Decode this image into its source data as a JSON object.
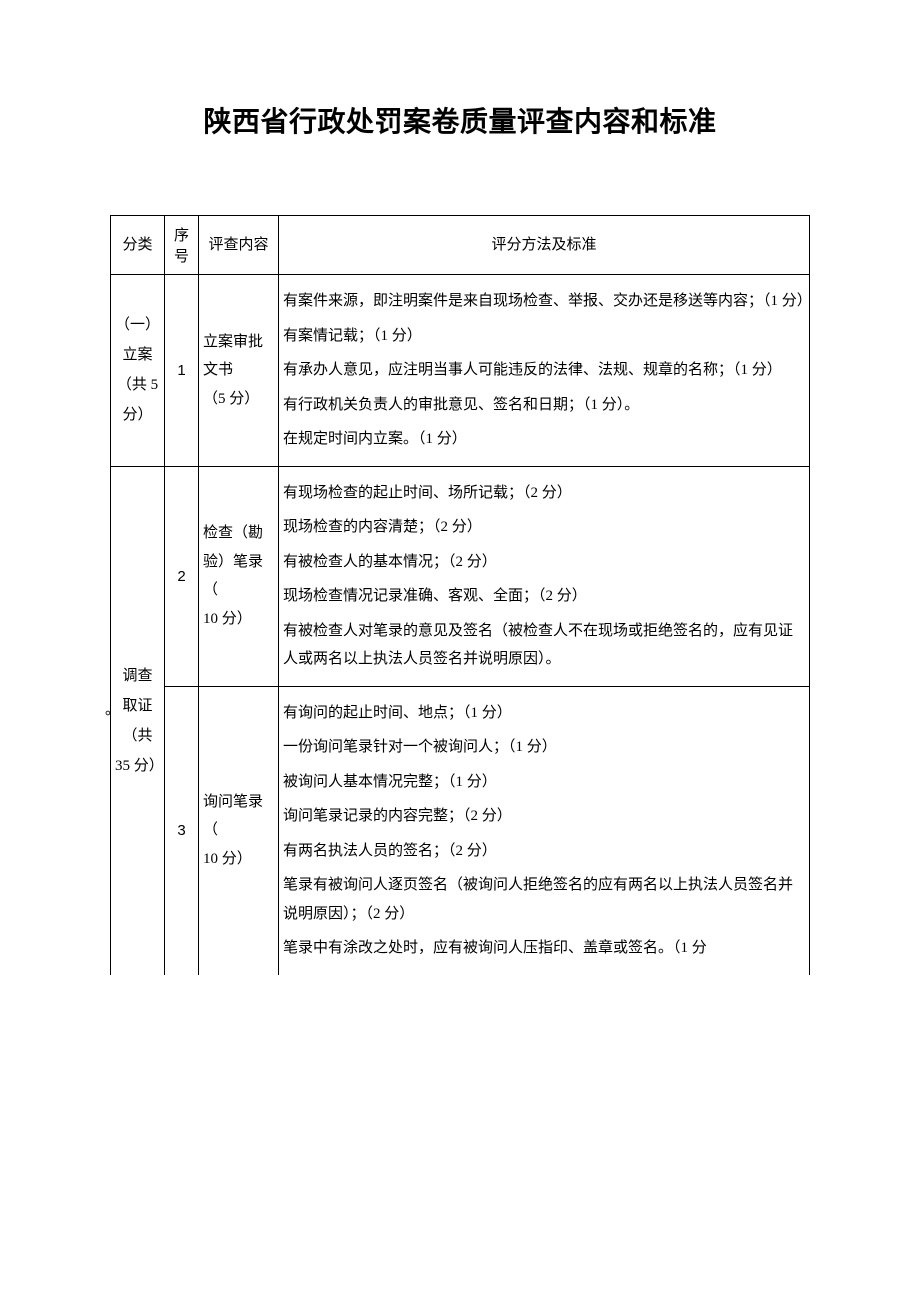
{
  "title": "陕西省行政处罚案卷质量评查内容和标准",
  "headers": {
    "category": "分类",
    "index": "序号",
    "content": "评查内容",
    "standard": "评分方法及标准"
  },
  "section1": {
    "category_line1": "（一）",
    "category_line2": "立案",
    "category_line3": "（共 5",
    "category_line4": "分）",
    "row1": {
      "index": "1",
      "content_line1": "立案审批",
      "content_line2": "文书",
      "content_line3": "（5 分）",
      "std1": "有案件来源，即注明案件是来自现场检查、举报、交办还是移送等内容；（1 分）",
      "std2": "有案情记载；（1 分）",
      "std3": "有承办人意见，应注明当事人可能违反的法律、法规、规章的名称；（1 分）",
      "std4": "有行政机关负责人的审批意见、签名和日期；（1 分）。",
      "std5": "在规定时间内立案。（1 分）"
    }
  },
  "section2": {
    "category_line1": "调查",
    "category_line2": "取证",
    "category_line3": "（共",
    "category_line4": "35 分）",
    "dot": "。",
    "row2": {
      "index": "2",
      "content_line1": "检查（勘",
      "content_line2": "验）笔录（",
      "content_line3": "10 分）",
      "std1": "有现场检查的起止时间、场所记载；（2 分）",
      "std2": "现场检查的内容清楚；（2 分）",
      "std3": "有被检查人的基本情况；（2 分）",
      "std4": "现场检查情况记录准确、客观、全面；（2 分）",
      "std5": "有被检查人对笔录的意见及签名（被检查人不在现场或拒绝签名的，应有见证人或两名以上执法人员签名并说明原因）。"
    },
    "row3": {
      "index": "3",
      "content_line1": "询问笔录（",
      "content_line2": "10 分）",
      "std1": "有询问的起止时间、地点；（1 分）",
      "std2": "一份询问笔录针对一个被询问人；（1 分）",
      "std3": "被询问人基本情况完整；（1 分）",
      "std4": "询问笔录记录的内容完整；（2 分）",
      "std5": "有两名执法人员的签名；（2 分）",
      "std6": "笔录有被询问人逐页签名（被询问人拒绝签名的应有两名以上执法人员签名并说明原因）；（2 分）",
      "std7": "笔录中有涂改之处时，应有被询问人压指印、盖章或签名。（1 分"
    }
  }
}
